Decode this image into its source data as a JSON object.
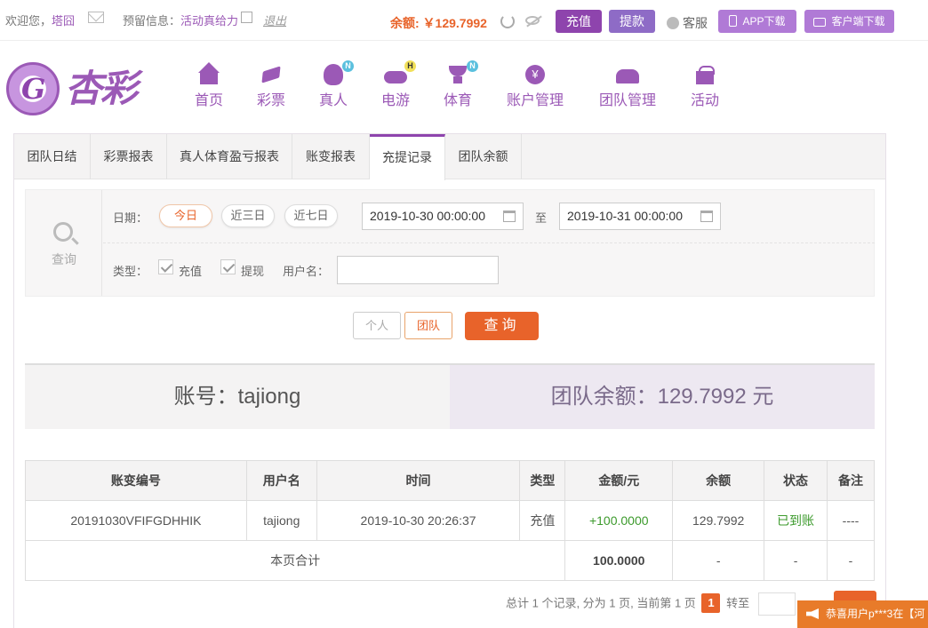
{
  "topbar": {
    "welcome_prefix": "欢迎您，",
    "username": "塔囧",
    "reserved_label": "预留信息：",
    "reserved_value": "活动真给力",
    "logout": "退出",
    "balance": "余额: ￥129.7992",
    "charge": "充值",
    "withdraw": "提款",
    "service": "客服",
    "app_download": "APP下载",
    "client_download": "客户端下载"
  },
  "logo": {
    "text": "杏彩"
  },
  "nav": [
    {
      "label": "首页"
    },
    {
      "label": "彩票"
    },
    {
      "label": "真人",
      "badge": "N"
    },
    {
      "label": "电游",
      "badge": "H"
    },
    {
      "label": "体育",
      "badge": "N"
    },
    {
      "label": "账户管理"
    },
    {
      "label": "团队管理"
    },
    {
      "label": "活动"
    }
  ],
  "tabs": [
    "团队日结",
    "彩票报表",
    "真人体育盈亏报表",
    "账变报表",
    "充提记录",
    "团队余额"
  ],
  "filter": {
    "side_label": "查询",
    "date_label": "日期：",
    "quick": [
      "今日",
      "近三日",
      "近七日"
    ],
    "date_from": "2019-10-30 00:00:00",
    "to_label": "至",
    "date_to": "2019-10-31 00:00:00",
    "type_label": "类型：",
    "type_charge": "充值",
    "type_withdraw": "提现",
    "user_label": "用户名：",
    "user_value": ""
  },
  "buttons": {
    "personal": "个人",
    "team": "团队",
    "query": "查询"
  },
  "summary": {
    "account": "账号：tajiong",
    "team_balance": "团队余额：129.7992 元"
  },
  "table": {
    "headers": [
      "账变编号",
      "用户名",
      "时间",
      "类型",
      "金额/元",
      "余额",
      "状态",
      "备注"
    ],
    "rows": [
      [
        "20191030VFIFGDHHIK",
        "tajiong",
        "2019-10-30 20:26:37",
        "充值",
        "+100.0000",
        "129.7992",
        "已到账",
        "----"
      ]
    ],
    "total_label": "本页合计",
    "total_amount": "100.0000",
    "total_balance": "-",
    "total_status": "-",
    "total_note": "-"
  },
  "pager": {
    "text": "总计 1 个记录, 分为 1 页, 当前第 1 页",
    "current": "1",
    "jump_label": "转至"
  },
  "notice": {
    "text": "恭喜用户p***3在【河"
  },
  "colors": {
    "brand": "#8e44ad",
    "accent": "#e8632a",
    "success": "#3c9a2c"
  }
}
